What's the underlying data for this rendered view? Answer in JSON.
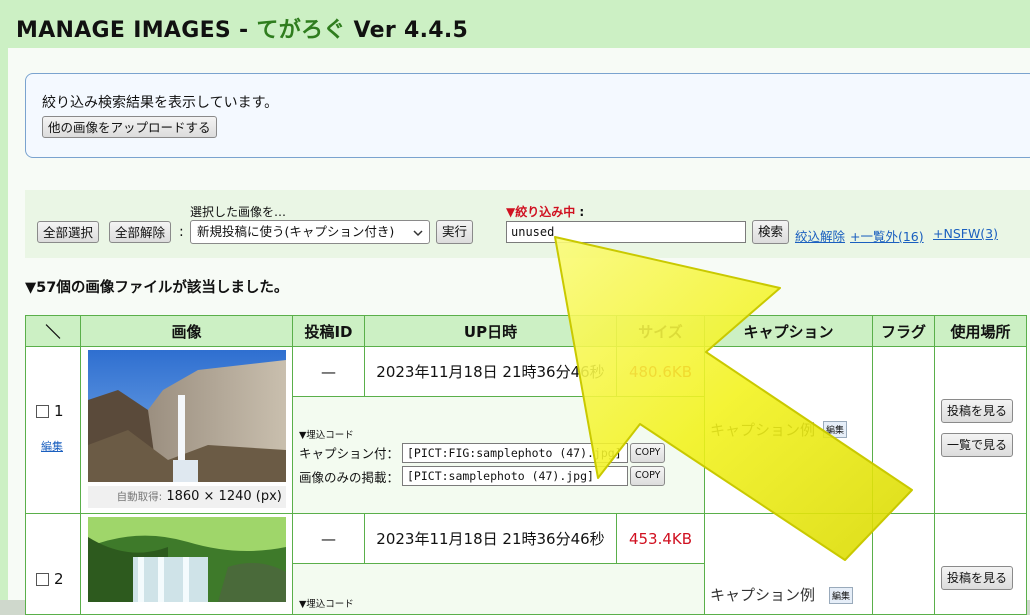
{
  "header": {
    "title_main": "MANAGE IMAGES - ",
    "title_app": "てがろぐ",
    "title_version": " Ver 4.4.5"
  },
  "notice": {
    "text": "絞り込み検索結果を表示しています。",
    "upload_label": "他の画像をアップロードする"
  },
  "toolbar": {
    "select_all": "全部選択",
    "deselect_all": "全部解除",
    "colon": ":",
    "selected_caption": "選択した画像を…",
    "action_value": "新規投稿に使う(キャプション付き)",
    "execute": "実行",
    "filter_label": "▼絞り込み中",
    "filter_colon": ":",
    "search_value": "unused",
    "search_button": "検索",
    "clear_filter": "絞込解除",
    "excluded_link": "+一覧外(16)",
    "nsfw_link": "+NSFW(3)"
  },
  "result_count": "▼57個の画像ファイルが該当しました。",
  "table": {
    "headers": [
      "＼",
      "画像",
      "投稿ID",
      "UP日時",
      "サイズ",
      "キャプション",
      "フラグ",
      "使用場所"
    ],
    "rows": [
      {
        "number": "1",
        "edit": "編集",
        "post_id": "—",
        "date": "2023年11月18日 21時36分46秒",
        "size": "480.6KB",
        "auto_label": "自動取得:",
        "dimensions": "1860 × 1240 (px)",
        "embed_title": "▼埋込コード",
        "embed_with_caption_label": "キャプション付：",
        "embed_with_caption_value": "[PICT:FIG:samplephoto (47).jpg]",
        "embed_image_only_label": "画像のみの掲載：",
        "embed_image_only_value": "[PICT:samplephoto (47).jpg]",
        "copy": "COPY",
        "caption": "キャプション例",
        "caption_edit": "編集",
        "view_post": "投稿を見る",
        "view_list": "一覧で見る"
      },
      {
        "number": "2",
        "post_id": "—",
        "date": "2023年11月18日 21時36分46秒",
        "size": "453.4KB",
        "embed_title": "▼埋込コード",
        "caption": "キャプション例",
        "caption_edit": "編集",
        "view_post": "投稿を見る"
      }
    ]
  },
  "colors": {
    "header_bg": "#ccf0c4",
    "border_green": "#5aaf4a",
    "size_red": "#d01020",
    "filter_red": "#d01020",
    "link_blue": "#1a5fbf",
    "arrow_yellow": "#f2f21a"
  },
  "icons": {
    "checkbox": "checkbox-icon",
    "dropdown": "chevron-down-icon",
    "overlay": "pointer-arrow-icon"
  }
}
